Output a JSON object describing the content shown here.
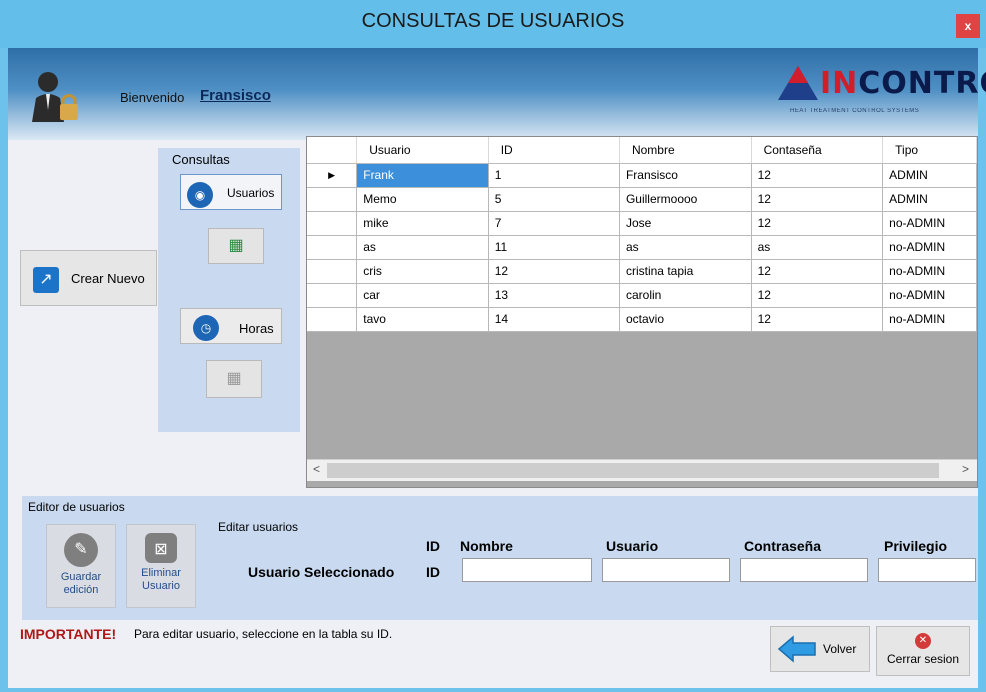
{
  "window": {
    "title": "CONSULTAS DE USUARIOS",
    "close_label": "x"
  },
  "header": {
    "welcome_label": "Bienvenido",
    "user_name": "Fransisco",
    "logo_in": "IN",
    "logo_rest": "CONTROL",
    "logo_sub": "HEAT TREATMENT CONTROL SYSTEMS"
  },
  "sidebar": {
    "crear_label": "Crear Nuevo",
    "consultas_label": "Consultas",
    "usuarios_label": "Usuarios",
    "horas_label": "Horas"
  },
  "grid": {
    "columns": [
      "Usuario",
      "ID",
      "Nombre",
      "Contaseña",
      "Tipo"
    ],
    "rows": [
      [
        "Frank",
        "1",
        "Fransisco",
        "12",
        "ADMIN"
      ],
      [
        "Memo",
        "5",
        "Guillermoooo",
        "12",
        "ADMIN"
      ],
      [
        "mike",
        "7",
        "Jose",
        "12",
        "no-ADMIN"
      ],
      [
        "as",
        "11",
        "as",
        "as",
        "no-ADMIN"
      ],
      [
        "cris",
        "12",
        "cristina tapia",
        "12",
        "no-ADMIN"
      ],
      [
        "car",
        "13",
        "carolin",
        "12",
        "no-ADMIN"
      ],
      [
        "tavo",
        "14",
        "octavio",
        "12",
        "no-ADMIN"
      ]
    ],
    "selected_row": 0,
    "selected_marker": "▶"
  },
  "editor": {
    "title": "Editor de usuarios",
    "subtitle": "Editar usuarios",
    "guardar_label_1": "Guardar",
    "guardar_label_2": "edición",
    "eliminar_label_1": "Eliminar",
    "eliminar_label_2": "Usuario",
    "hdr_id": "ID",
    "hdr_nombre": "Nombre",
    "hdr_usuario": "Usuario",
    "hdr_contrasena": "Contraseña",
    "hdr_privilegio": "Privilegio",
    "selected_label": "Usuario Seleccionado",
    "selected_id": "ID",
    "nombre_value": "",
    "usuario_value": "",
    "contrasena_value": "",
    "privilegio_value": ""
  },
  "footer": {
    "important_label": "IMPORTANTE!",
    "important_msg": "Para editar usuario, seleccione en la tabla su ID.",
    "volver_label": "Volver",
    "cerrar_label": "Cerrar sesion"
  },
  "colors": {
    "accent": "#3b8fdb",
    "titlebar": "#63bfea",
    "important": "#b01818"
  }
}
